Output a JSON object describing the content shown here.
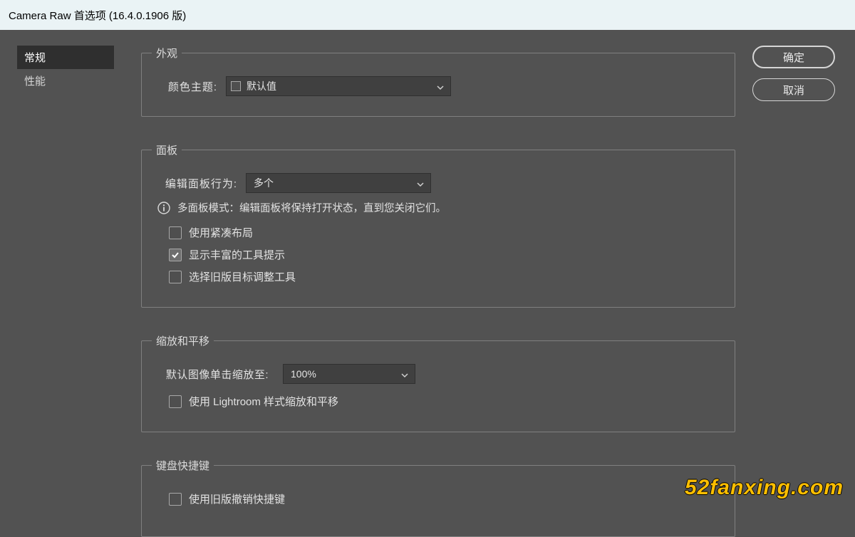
{
  "window": {
    "title": "Camera Raw 首选项  (16.4.0.1906 版)"
  },
  "sidebar": {
    "items": [
      {
        "label": "常规",
        "active": true
      },
      {
        "label": "性能",
        "active": false
      }
    ]
  },
  "buttons": {
    "ok": "确定",
    "cancel": "取消"
  },
  "appearance": {
    "legend": "外观",
    "theme_label": "颜色主题:",
    "theme_value": "默认值"
  },
  "panel": {
    "legend": "面板",
    "edit_behavior_label": "编辑面板行为:",
    "edit_behavior_value": "多个",
    "info_text": "多面板模式：编辑面板将保持打开状态，直到您关闭它们。",
    "compact_label": "使用紧凑布局",
    "compact_checked": false,
    "rich_tooltips_label": "显示丰富的工具提示",
    "rich_tooltips_checked": true,
    "legacy_target_label": "选择旧版目标调整工具",
    "legacy_target_checked": false
  },
  "zoom": {
    "legend": "缩放和平移",
    "default_zoom_label": "默认图像单击缩放至:",
    "default_zoom_value": "100%",
    "lightroom_label": "使用 Lightroom 样式缩放和平移",
    "lightroom_checked": false
  },
  "keyboard": {
    "legend": "键盘快捷键",
    "legacy_undo_label": "使用旧版撤销快捷键",
    "legacy_undo_checked": false
  },
  "watermark": "52fanxing.com"
}
